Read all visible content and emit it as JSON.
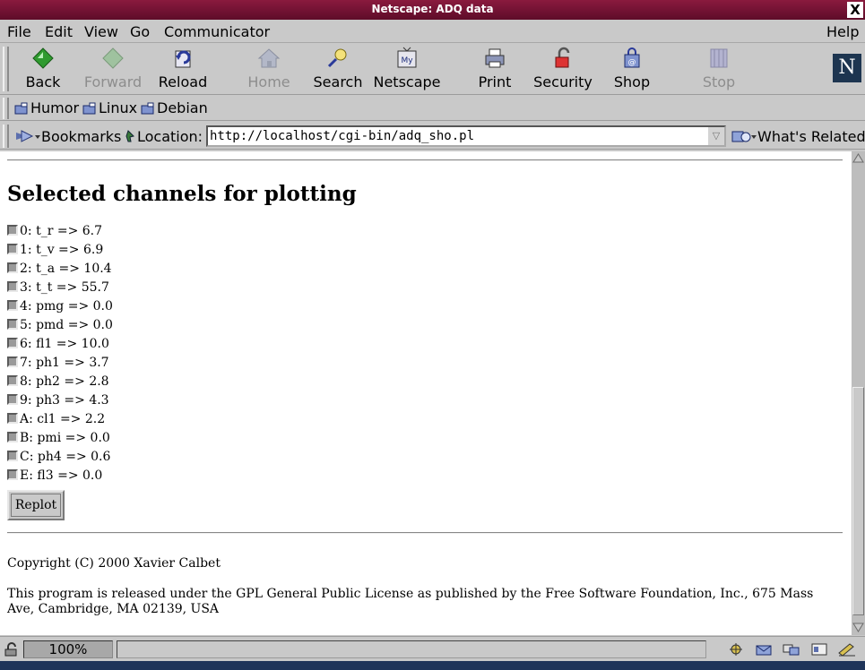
{
  "window": {
    "title": "Netscape: ADQ data",
    "close_glyph": "X"
  },
  "menu": {
    "items": [
      "File",
      "Edit",
      "View",
      "Go",
      "Communicator"
    ],
    "help": "Help"
  },
  "toolbar": {
    "buttons": [
      {
        "label": "Back",
        "icon": "back-arrow-icon",
        "enabled": true
      },
      {
        "label": "Forward",
        "icon": "forward-arrow-icon",
        "enabled": false
      },
      {
        "label": "Reload",
        "icon": "reload-icon",
        "enabled": true
      },
      {
        "label": "Home",
        "icon": "home-icon",
        "enabled": false
      },
      {
        "label": "Search",
        "icon": "search-icon",
        "enabled": true
      },
      {
        "label": "Netscape",
        "icon": "my-netscape-icon",
        "enabled": true
      },
      {
        "label": "Print",
        "icon": "printer-icon",
        "enabled": true
      },
      {
        "label": "Security",
        "icon": "padlock-icon",
        "enabled": true
      },
      {
        "label": "Shop",
        "icon": "shopping-bag-icon",
        "enabled": true
      },
      {
        "label": "Stop",
        "icon": "stop-icon",
        "enabled": false
      }
    ],
    "logo": "N"
  },
  "personal_toolbar": {
    "links": [
      "Humor",
      "Linux",
      "Debian"
    ]
  },
  "location_bar": {
    "bookmarks_label": "Bookmarks",
    "location_label": "Location:",
    "url": "http://localhost/cgi-bin/adq_sho.pl",
    "whats_related": "What's Related"
  },
  "page": {
    "heading": "Selected channels for plotting",
    "channels": [
      "0: t_r => 6.7",
      "1: t_v => 6.9",
      "2: t_a => 10.4",
      "3: t_t => 55.7",
      "4: pmg => 0.0",
      "5: pmd => 0.0",
      "6: fl1 => 10.0",
      "7: ph1 => 3.7",
      "8: ph2 => 2.8",
      "9: ph3 => 4.3",
      "A: cl1 => 2.2",
      "B: pmi => 0.0",
      "C: ph4 => 0.6",
      "E: fl3 => 0.0"
    ],
    "replot_label": "Replot",
    "copyright": "Copyright (C) 2000 Xavier Calbet",
    "license": "This program is released under the GPL General Public License as published by the Free Software Foundation, Inc., 675 Mass Ave, Cambridge, MA 02139, USA"
  },
  "status": {
    "zoom": "100%"
  }
}
